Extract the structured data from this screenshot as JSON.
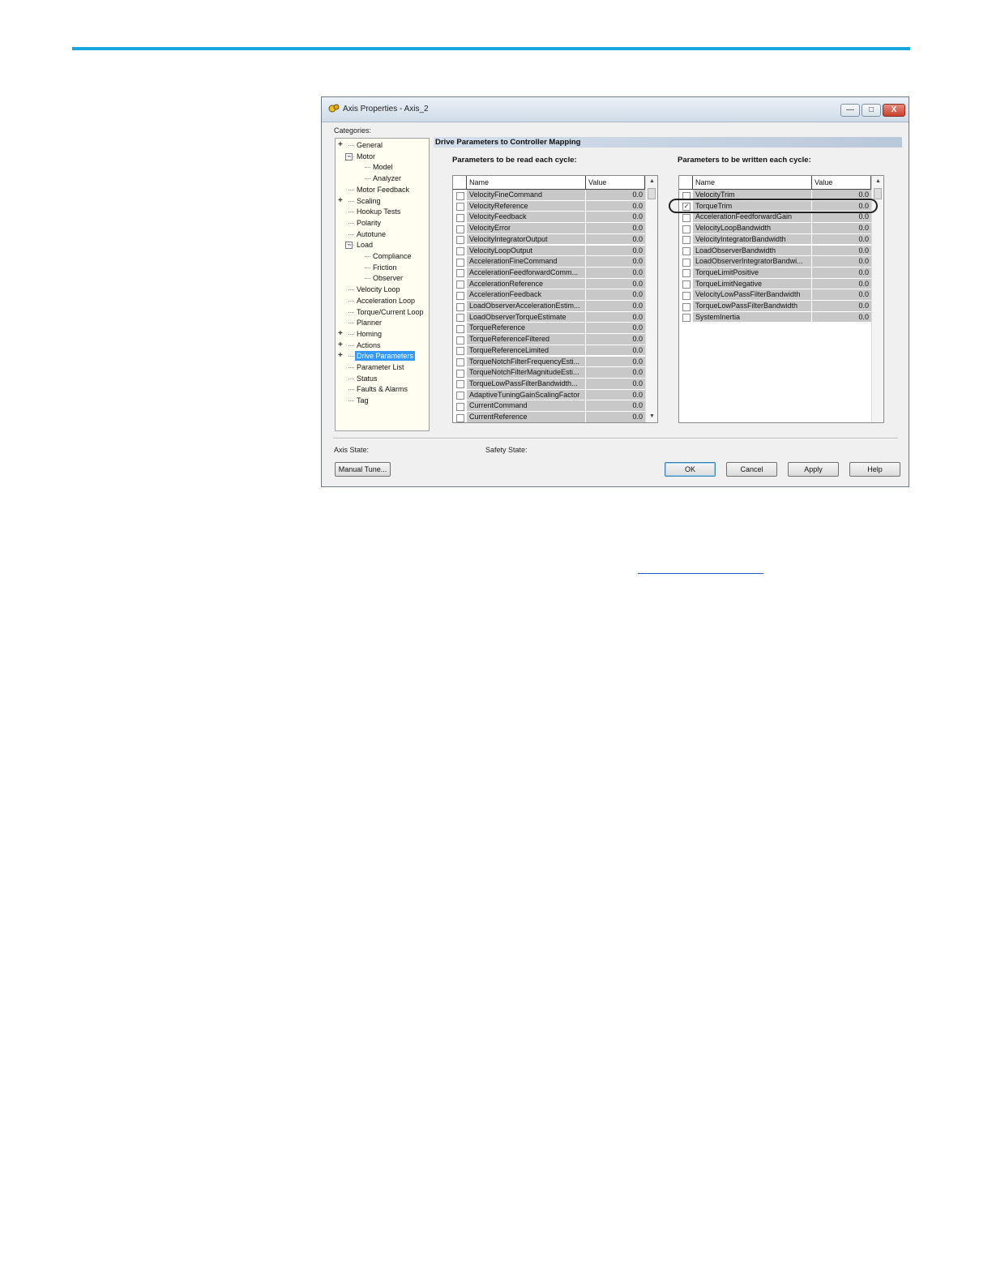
{
  "window": {
    "title": "Axis Properties - Axis_2",
    "buttons": {
      "minimize": "—",
      "maximize": "□",
      "close": "X"
    }
  },
  "categories": {
    "label": "Categories:",
    "items": [
      {
        "label": "General",
        "expander": "plus"
      },
      {
        "label": "Motor",
        "expander": "minus"
      },
      {
        "label": "Model"
      },
      {
        "label": "Analyzer"
      },
      {
        "label": "Motor Feedback"
      },
      {
        "label": "Scaling",
        "expander": "plus"
      },
      {
        "label": "Hookup Tests"
      },
      {
        "label": "Polarity"
      },
      {
        "label": "Autotune"
      },
      {
        "label": "Load",
        "expander": "minus"
      },
      {
        "label": "Compliance"
      },
      {
        "label": "Friction"
      },
      {
        "label": "Observer"
      },
      {
        "label": "Velocity Loop"
      },
      {
        "label": "Acceleration Loop"
      },
      {
        "label": "Torque/Current Loop"
      },
      {
        "label": "Planner"
      },
      {
        "label": "Homing",
        "expander": "plus"
      },
      {
        "label": "Actions",
        "expander": "plus"
      },
      {
        "label": "Drive Parameters",
        "expander": "plus",
        "selected": true
      },
      {
        "label": "Parameter List"
      },
      {
        "label": "Status"
      },
      {
        "label": "Faults & Alarms"
      },
      {
        "label": "Tag"
      }
    ]
  },
  "section_title": "Drive Parameters to Controller Mapping",
  "read_group": {
    "title": "Parameters to be read each cycle:",
    "columns": [
      "Name",
      "Value"
    ],
    "rows": [
      {
        "name": "VelocityFineCommand",
        "value": "0.0",
        "checked": false
      },
      {
        "name": "VelocityReference",
        "value": "0.0",
        "checked": false
      },
      {
        "name": "VelocityFeedback",
        "value": "0.0",
        "checked": false
      },
      {
        "name": "VelocityError",
        "value": "0.0",
        "checked": false
      },
      {
        "name": "VelocityIntegratorOutput",
        "value": "0.0",
        "checked": false
      },
      {
        "name": "VelocityLoopOutput",
        "value": "0.0",
        "checked": false
      },
      {
        "name": "AccelerationFineCommand",
        "value": "0.0",
        "checked": false
      },
      {
        "name": "AccelerationFeedforwardComm...",
        "value": "0.0",
        "checked": false
      },
      {
        "name": "AccelerationReference",
        "value": "0.0",
        "checked": false
      },
      {
        "name": "AccelerationFeedback",
        "value": "0.0",
        "checked": false
      },
      {
        "name": "LoadObserverAccelerationEstim...",
        "value": "0.0",
        "checked": false
      },
      {
        "name": "LoadObserverTorqueEstimate",
        "value": "0.0",
        "checked": false
      },
      {
        "name": "TorqueReference",
        "value": "0.0",
        "checked": false
      },
      {
        "name": "TorqueReferenceFiltered",
        "value": "0.0",
        "checked": false
      },
      {
        "name": "TorqueReferenceLimited",
        "value": "0.0",
        "checked": false
      },
      {
        "name": "TorqueNotchFilterFrequencyEsti...",
        "value": "0.0",
        "checked": false
      },
      {
        "name": "TorqueNotchFilterMagnitudeEsti...",
        "value": "0.0",
        "checked": false
      },
      {
        "name": "TorqueLowPassFilterBandwidth...",
        "value": "0.0",
        "checked": false
      },
      {
        "name": "AdaptiveTuningGainScalingFactor",
        "value": "0.0",
        "checked": false
      },
      {
        "name": "CurrentCommand",
        "value": "0.0",
        "checked": false
      },
      {
        "name": "CurrentReference",
        "value": "0.0",
        "checked": false
      }
    ]
  },
  "write_group": {
    "title": "Parameters to be written each cycle:",
    "columns": [
      "Name",
      "Value"
    ],
    "rows": [
      {
        "name": "VelocityTrim",
        "value": "0.0",
        "checked": false
      },
      {
        "name": "TorqueTrim",
        "value": "0.0",
        "checked": true
      },
      {
        "name": "AccelerationFeedforwardGain",
        "value": "0.0",
        "checked": false
      },
      {
        "name": "VelocityLoopBandwidth",
        "value": "0.0",
        "checked": false
      },
      {
        "name": "VelocityIntegratorBandwidth",
        "value": "0.0",
        "checked": false
      },
      {
        "name": "LoadObserverBandwidth",
        "value": "0.0",
        "checked": false
      },
      {
        "name": "LoadObserverIntegratorBandwi...",
        "value": "0.0",
        "checked": false
      },
      {
        "name": "TorqueLimitPositive",
        "value": "0.0",
        "checked": false
      },
      {
        "name": "TorqueLimitNegative",
        "value": "0.0",
        "checked": false
      },
      {
        "name": "VelocityLowPassFilterBandwidth",
        "value": "0.0",
        "checked": false
      },
      {
        "name": "TorqueLowPassFilterBandwidth",
        "value": "0.0",
        "checked": false
      },
      {
        "name": "SystemInertia",
        "value": "0.0",
        "checked": false
      }
    ]
  },
  "footer": {
    "axis_state_label": "Axis State:",
    "safety_state_label": "Safety State:",
    "manual_tune": "Manual Tune...",
    "ok": "OK",
    "cancel": "Cancel",
    "apply": "Apply",
    "help": "Help"
  },
  "colors": {
    "accent_rule": "#19a6de",
    "selection": "#3399ff",
    "grid_cell": "#c8c8c8"
  }
}
